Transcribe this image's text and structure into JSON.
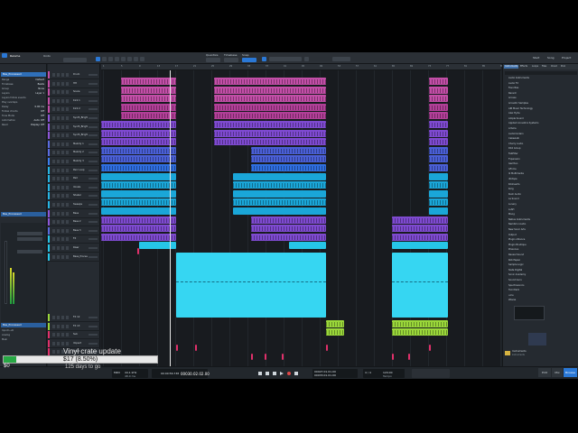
{
  "toolbar": {
    "song_title": "Relume",
    "undo_label": "Undo",
    "quantize_label": "Quantize",
    "timebase_label": "Timebase",
    "snap_label": "Snap",
    "start_label": "Start",
    "song_label": "Song",
    "project_label": "Project"
  },
  "inspector": {
    "header": "Bas_Processed",
    "rows": [
      {
        "label": "Range",
        "value": "Default"
      },
      {
        "label": "Timebase",
        "value": "Beats"
      },
      {
        "label": "Group",
        "value": "None"
      },
      {
        "label": "Layers",
        "value": "Layer 1"
      },
      {
        "label": "Layers follow events",
        "value": ""
      },
      {
        "label": "Play overlaps",
        "value": ""
      },
      {
        "label": "Delay",
        "value": "0.00 ms"
      },
      {
        "label": "Follow chords",
        "value": "Off"
      },
      {
        "label": "Tune Mode",
        "value": "Off"
      },
      {
        "label": "Automation",
        "value": "Auto: Off"
      },
      {
        "label": "Read",
        "value": "Display: Off"
      }
    ],
    "channel_name": "Bas_Processed",
    "channel2_name": "Bas_Processed",
    "channel2_rows": [
      "Input L+R",
      "Analog",
      "Main"
    ]
  },
  "tracks": [
    {
      "name": "Drum",
      "color": "#c24ea7"
    },
    {
      "name": "HH",
      "color": "#c24ea7"
    },
    {
      "name": "Snare",
      "color": "#c24ea7"
    },
    {
      "name": "Kick 1",
      "color": "#c24ea7"
    },
    {
      "name": "Kick 2",
      "color": "#c24ea7"
    },
    {
      "name": "Synth_Bright",
      "color": "#8e56d8"
    },
    {
      "name": "Synth_Bright",
      "color": "#8e56d8"
    },
    {
      "name": "Synth_Bright",
      "color": "#8e56d8"
    },
    {
      "name": "Melody 1",
      "color": "#5a6be0"
    },
    {
      "name": "Melody 2",
      "color": "#5a6be0"
    },
    {
      "name": "Melody 3",
      "color": "#3c7df0"
    },
    {
      "name": "Perc Loop",
      "color": "#26b6e4"
    },
    {
      "name": "Pad",
      "color": "#26b6e4"
    },
    {
      "name": "Vocals",
      "color": "#26b6e4"
    },
    {
      "name": "Shaker",
      "color": "#26b6e4"
    },
    {
      "name": "Sweeps",
      "color": "#26b6e4"
    },
    {
      "name": "Bass",
      "color": "#8e56d8"
    },
    {
      "name": "Bass 2",
      "color": "#8e56d8"
    },
    {
      "name": "Bass 3",
      "color": "#5a6be0"
    },
    {
      "name": "FX",
      "color": "#26c6e8"
    },
    {
      "name": "Riser",
      "color": "#26c6e8"
    },
    {
      "name": "Bass_Processed",
      "color": "#26c6e8"
    }
  ],
  "lower_tracks": [
    {
      "name": "FX 12",
      "color": "#9ad73a"
    },
    {
      "name": "FX 13",
      "color": "#9ad73a"
    },
    {
      "name": "Sub",
      "color": "#e0306a"
    },
    {
      "name": "Impact",
      "color": "#e0306a"
    },
    {
      "name": "Crash",
      "color": "#e0306a"
    }
  ],
  "ruler_ticks": [
    "1",
    "5",
    "9",
    "13",
    "17",
    "21",
    "25",
    "29",
    "33",
    "37",
    "41",
    "45",
    "49",
    "53",
    "57",
    "61",
    "65",
    "69",
    "73",
    "77",
    "81",
    "85",
    "89"
  ],
  "browser": {
    "tabs": [
      "Instruments",
      "Effects",
      "Loops",
      "Files",
      "Cloud",
      "Pool"
    ],
    "items": [
      "Audio Instruments",
      "Audio FX",
      "Favorites",
      "Recent",
      "Access",
      "Acoustic Samples",
      "AIR Music Technology",
      "Alex Hyde",
      "Ample Sound",
      "Applied Acoustics Systems",
      "Arturia",
      "Audiomodern",
      "Cakewalk",
      "Cherry Audio",
      "D16 Group",
      "FabFilter",
      "Fxpansion",
      "Garritan",
      "GForce",
      "Ik Multimedia",
      "iZotope",
      "Kilohearts",
      "Korg",
      "Kush Audio",
      "Le Sound",
      "Lunacy",
      "LuSH",
      "Moog",
      "Native Instruments",
      "Nembrini Audio",
      "New Sonic Arts",
      "Output",
      "Plugin Alliance",
      "Plugin Boutique",
      "Presonus",
      "Reveal Sound",
      "Rob Papen",
      "Sample Logic",
      "Slate Digital",
      "Sonic Academy",
      "Sound Guru",
      "Spectrasonics",
      "Toontrack",
      "u-he",
      "Waves"
    ],
    "bottom_label": "Instruments",
    "bottom_sub": "Instruments",
    "side_buttons": [
      "Edit",
      "Mix",
      "Browse"
    ]
  },
  "transport": {
    "cpu": "MIDI",
    "sample_rate": "44.1 kHz",
    "latency": "48.0 ms",
    "position": "00030.02.02.00",
    "time": "00:00:56.738",
    "left_locator": "00027.01.01.00",
    "right_locator": "00033.01.01.00",
    "tempo": "120.00",
    "signature": "4 / 4",
    "key": "Tempo"
  },
  "overlay": {
    "status_line": "Vinyl crate update",
    "progress_text": "$17 (8.50%)",
    "progress_fraction": 0.085,
    "bottom_left": "$0",
    "bottom_sub": "125 days to go"
  }
}
